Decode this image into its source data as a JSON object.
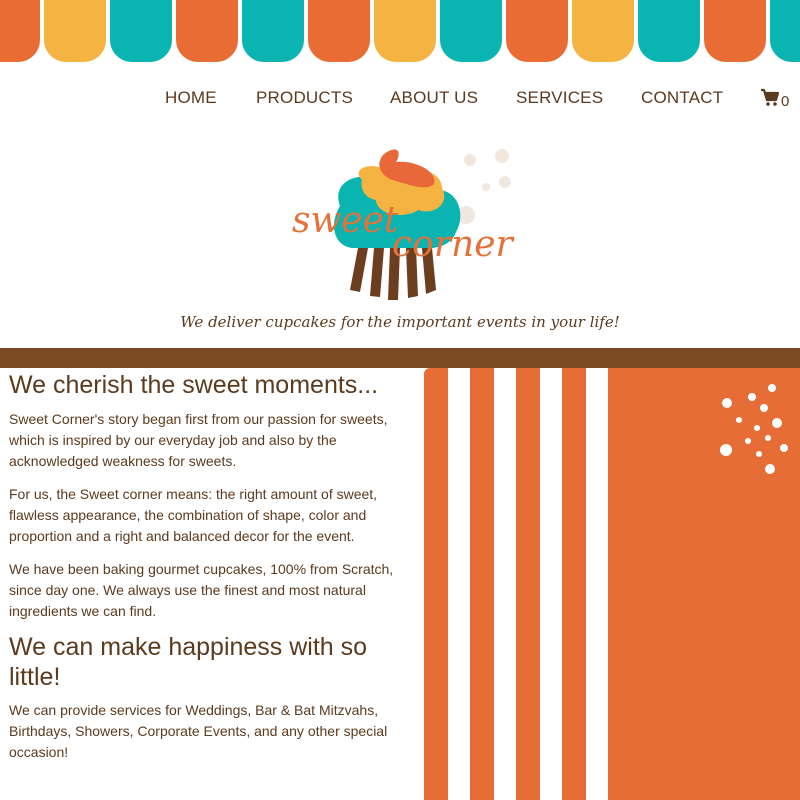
{
  "colors": {
    "orange": "#e86c34",
    "yellow": "#f5b442",
    "teal": "#0ab4b0",
    "brown": "#7a4a24",
    "text_brown": "#5b3a1e"
  },
  "awning": {
    "pattern": [
      "orange",
      "yellow",
      "teal",
      "orange",
      "teal",
      "orange",
      "yellow",
      "teal",
      "orange",
      "yellow",
      "teal",
      "orange",
      "teal"
    ]
  },
  "nav": {
    "items": [
      {
        "label": "HOME"
      },
      {
        "label": "PRODUCTS"
      },
      {
        "label": "ABOUT US"
      },
      {
        "label": "SERVICES"
      },
      {
        "label": "CONTACT"
      }
    ],
    "cart": {
      "icon": "shopping-cart-icon",
      "count": "0"
    }
  },
  "logo": {
    "word_1": "sweet",
    "word_2": "corner",
    "tagline": "We deliver cupcakes for the important events in your life!"
  },
  "content": {
    "heading_1": "We cherish the sweet moments...",
    "paragraph_1": "Sweet Corner's story began first from our passion for sweets, which is inspired by our everyday job and also by the acknowledged weakness for sweets.",
    "paragraph_2": "For us, the Sweet corner means: the right amount of sweet, flawless appearance, the combination of shape, color and proportion and a right and balanced decor for the event.",
    "paragraph_3": "We have been baking gourmet cupcakes, 100% from Scratch, since day one. We always use the finest and most natural ingredients we can find.",
    "heading_2": "We can make happiness with so little!",
    "paragraph_4": "We can provide services for Weddings, Bar & Bat Mitzvahs, Birthdays, Showers, Corporate Events, and any other special occasion!"
  }
}
